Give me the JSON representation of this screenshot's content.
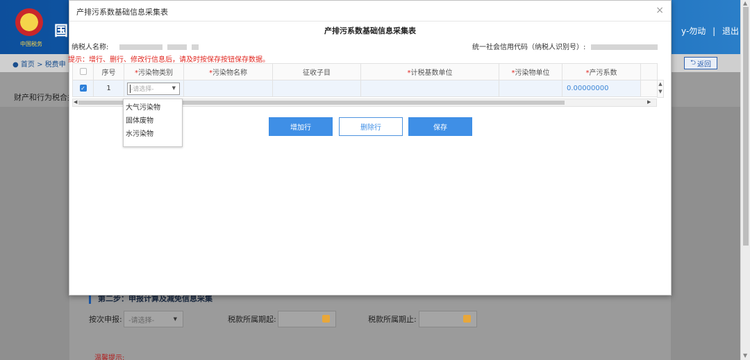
{
  "background": {
    "logo_text": "中国税务",
    "site_title": "国",
    "user": "y-勿动",
    "logout": "退出",
    "breadcrumb_home": "首页",
    "breadcrumb_next": "税费申",
    "back_button": "返回",
    "sub_label": "财产和行为税合并",
    "step_title": "第二步：申报计算及减免信息采集",
    "declare_label": "按次申报:",
    "declare_placeholder": "-请选择-",
    "period_start_label": "税款所属期起:",
    "period_end_label": "税款所属期止:",
    "warm_tip": "温馨提示:"
  },
  "modal": {
    "title": "产排污系数基础信息采集表",
    "close": "×",
    "heading": "产排污系数基础信息采集表",
    "taxpayer_label": "纳税人名称:",
    "credit_label": "统一社会信用代码（纳税人识别号）:",
    "hint": "提示：增行、删行、修改行信息后，请及时按保存按钮保存数据。"
  },
  "table": {
    "columns": [
      {
        "label": "",
        "required": false
      },
      {
        "label": "序号",
        "required": false
      },
      {
        "label": "污染物类别",
        "required": true
      },
      {
        "label": "污染物名称",
        "required": true
      },
      {
        "label": "征收子目",
        "required": false
      },
      {
        "label": "计税基数单位",
        "required": true
      },
      {
        "label": "污染物单位",
        "required": true
      },
      {
        "label": "产污系数",
        "required": true
      },
      {
        "label": "",
        "required": false
      }
    ],
    "row": {
      "seq": "1",
      "category_placeholder": "-请选择-",
      "coefficient": "0.00000000"
    }
  },
  "dropdown": {
    "options": [
      "大气污染物",
      "固体废物",
      "水污染物"
    ]
  },
  "buttons": {
    "add": "增加行",
    "delete": "删除行",
    "save": "保存"
  }
}
